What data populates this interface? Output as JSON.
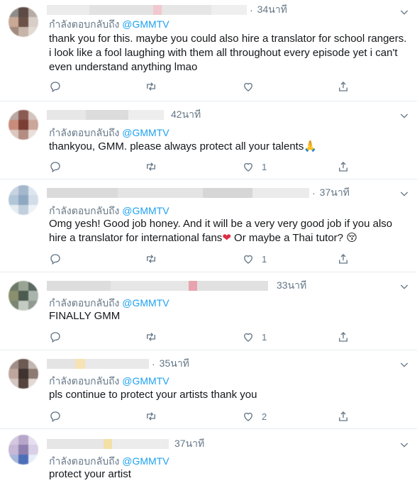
{
  "tweets": [
    {
      "time": "34นาที",
      "replying_prefix": "กำลังตอบกลับถึง",
      "replying_handle": "@GMMTV",
      "text_lines": [
        "thank you for this. maybe you could also hire a translator for school rangers.",
        "i look like a fool laughing with them all throughout every episode yet i can't",
        "even understand anything lmao"
      ],
      "like_count": ""
    },
    {
      "time": "42นาที",
      "replying_prefix": "กำลังตอบกลับถึง",
      "replying_handle": "@GMMTV",
      "text_lines": [
        "thankyou, GMM. please always protect all your talents"
      ],
      "emoji": "🙏",
      "like_count": "1"
    },
    {
      "time": "37นาที",
      "replying_prefix": "กำลังตอบกลับถึง",
      "replying_handle": "@GMMTV",
      "text_line1": "Omg yesh! Good job honey. And it will be a very very good job if you also",
      "text_line2a": "hire a translator for international fans",
      "text_line2b": " Or maybe a Thai tutor? ",
      "emoji_heart": "❤",
      "emoji_face": "😚",
      "like_count": "1"
    },
    {
      "time": "33นาที",
      "replying_prefix": "กำลังตอบกลับถึง",
      "replying_handle": "@GMMTV",
      "text_lines": [
        "FINALLY GMM"
      ],
      "like_count": "1"
    },
    {
      "time": "35นาที",
      "replying_prefix": "กำลังตอบกลับถึง",
      "replying_handle": "@GMMTV",
      "text_lines": [
        "pls continue to protect your artists thank you"
      ],
      "like_count": "2"
    },
    {
      "time": "37นาที",
      "replying_prefix": "กำลังตอบกลับถึง",
      "replying_handle": "@GMMTV",
      "text_lines": [
        "protect your artist"
      ],
      "like_count": ""
    }
  ],
  "icons": {
    "reply": "reply-icon",
    "retweet": "retweet-icon",
    "like": "like-icon",
    "share": "share-icon",
    "caret": "chevron-down-icon"
  },
  "colors": {
    "link": "#1da1f2",
    "secondary_text": "#657786",
    "divider": "#e6ecf0"
  }
}
